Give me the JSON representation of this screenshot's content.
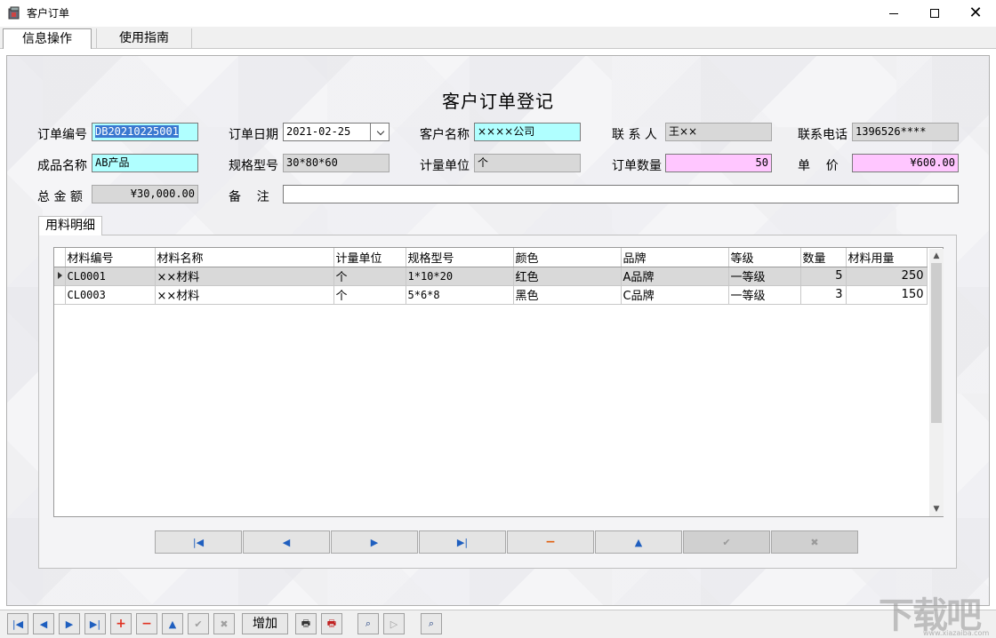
{
  "window": {
    "title": "客户订单"
  },
  "top_tabs": [
    "信息操作",
    "使用指南"
  ],
  "form": {
    "heading": "客户订单登记",
    "labels": {
      "order_no": "订单编号",
      "order_date": "订单日期",
      "customer": "客户名称",
      "contact": "联 系 人",
      "phone": "联系电话",
      "product": "成品名称",
      "spec": "规格型号",
      "unit": "计量单位",
      "qty": "订单数量",
      "price": "单    价",
      "total": "总 金 额",
      "remark": "备    注"
    },
    "values": {
      "order_no": "DB20210225001",
      "order_date": "2021-02-25",
      "customer": "××××公司",
      "contact": "王××",
      "phone": "1396526****",
      "product": "AB产品",
      "spec": "30*80*60",
      "unit": "个",
      "qty": "50",
      "price": "¥600.00",
      "total": "¥30,000.00",
      "remark": ""
    }
  },
  "sub_tab": "用料明细",
  "grid": {
    "columns": [
      "材料编号",
      "材料名称",
      "计量单位",
      "规格型号",
      "颜色",
      "品牌",
      "等级",
      "数量",
      "材料用量"
    ],
    "rows": [
      [
        "CL0001",
        "××材料",
        "个",
        "1*10*20",
        "红色",
        "A品牌",
        "一等级",
        "5",
        "250"
      ],
      [
        "CL0003",
        "××材料",
        "个",
        "5*6*8",
        "黑色",
        "C品牌",
        "一等级",
        "3",
        "150"
      ]
    ]
  },
  "toolbar": {
    "add_label": "增加"
  },
  "watermark": {
    "text": "下载吧",
    "sub": "www.xiazaiba.com"
  }
}
